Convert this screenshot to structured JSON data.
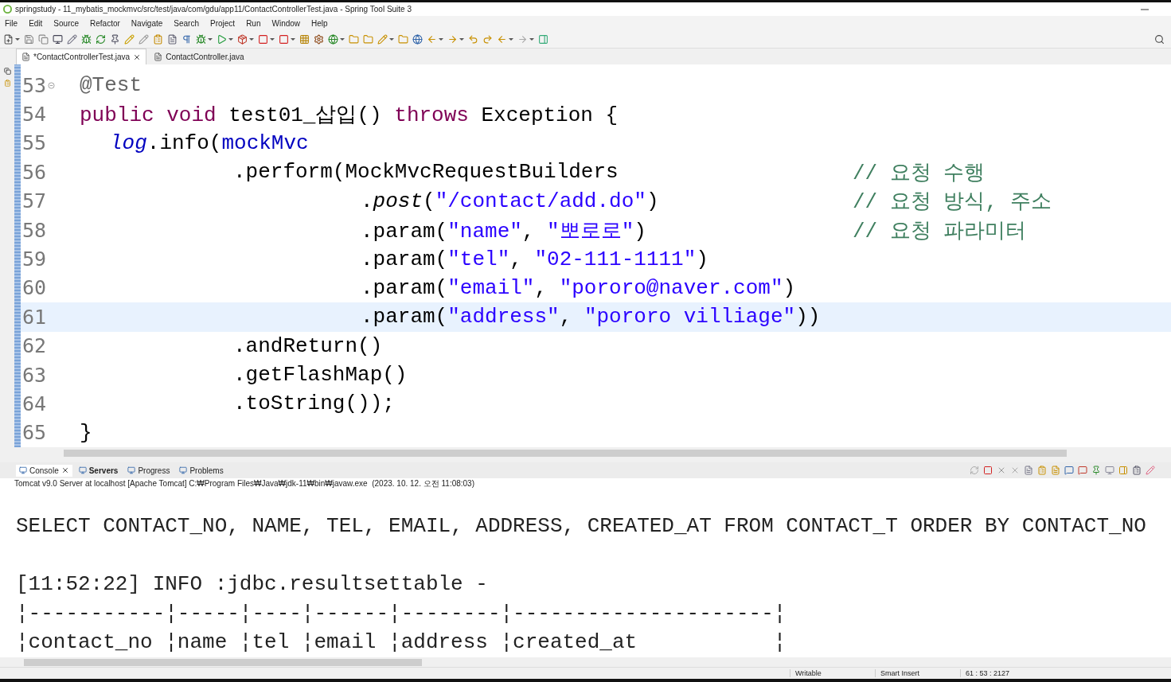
{
  "window": {
    "title": "springstudy - 11_mybatis_mockmvc/src/test/java/com/gdu/app11/ContactControllerTest.java - Spring Tool Suite 3"
  },
  "menu": [
    "File",
    "Edit",
    "Source",
    "Refactor",
    "Navigate",
    "Search",
    "Project",
    "Run",
    "Window",
    "Help"
  ],
  "editor_tabs": [
    {
      "label": "*ContactControllerTest.java",
      "selected": true
    },
    {
      "label": "ContactController.java",
      "selected": false
    }
  ],
  "editor": {
    "lines": [
      {
        "number": "53",
        "current": false,
        "fold": true,
        "segments": [
          {
            "kind": "annotation",
            "text": "@Test"
          }
        ]
      },
      {
        "number": "54",
        "current": false,
        "fold": false,
        "segments": [
          {
            "kind": "keyword",
            "text": "public void"
          },
          {
            "kind": "plain",
            "text": " test01_삽입() "
          },
          {
            "kind": "keyword",
            "text": "throws"
          },
          {
            "kind": "plain",
            "text": " Exception {"
          }
        ],
        "children": [
          {
            "number": "55",
            "current": false,
            "fold": false,
            "segments": [
              {
                "kind": "static",
                "text": "log"
              },
              {
                "kind": "plain",
                "text": ".info("
              },
              {
                "kind": "field",
                "text": "mockMvc"
              }
            ],
            "children": [
              {
                "number": "56",
                "current": false,
                "fold": false,
                "segments": [
                  {
                    "kind": "plain",
                    "text": ".perform(MockMvcRequestBuilders"
                  }
                ],
                "comment": "// 요청 수행",
                "children": [
                  {
                    "number": "57",
                    "current": false,
                    "fold": false,
                    "segments": [
                      {
                        "kind": "plain",
                        "text": "."
                      },
                      {
                        "kind": "method",
                        "text": "post"
                      },
                      {
                        "kind": "plain",
                        "text": "("
                      },
                      {
                        "kind": "string",
                        "text": "\"/contact/add.do\""
                      },
                      {
                        "kind": "plain",
                        "text": ")"
                      }
                    ],
                    "comment": "// 요청 방식, 주소"
                  },
                  {
                    "number": "58",
                    "current": false,
                    "fold": false,
                    "segments": [
                      {
                        "kind": "plain",
                        "text": ".param("
                      },
                      {
                        "kind": "string",
                        "text": "\"name\""
                      },
                      {
                        "kind": "plain",
                        "text": ", "
                      },
                      {
                        "kind": "string",
                        "text": "\"뽀로로\""
                      },
                      {
                        "kind": "plain",
                        "text": ")"
                      }
                    ],
                    "comment": "// 요청 파라미터"
                  },
                  {
                    "number": "59",
                    "current": false,
                    "fold": false,
                    "segments": [
                      {
                        "kind": "plain",
                        "text": ".param("
                      },
                      {
                        "kind": "string",
                        "text": "\"tel\""
                      },
                      {
                        "kind": "plain",
                        "text": ", "
                      },
                      {
                        "kind": "string",
                        "text": "\"02-111-1111\""
                      },
                      {
                        "kind": "plain",
                        "text": ")"
                      }
                    ]
                  },
                  {
                    "number": "60",
                    "current": false,
                    "fold": false,
                    "segments": [
                      {
                        "kind": "plain",
                        "text": ".param("
                      },
                      {
                        "kind": "string",
                        "text": "\"email\""
                      },
                      {
                        "kind": "plain",
                        "text": ", "
                      },
                      {
                        "kind": "string",
                        "text": "\"pororo@naver.com\""
                      },
                      {
                        "kind": "plain",
                        "text": ")"
                      }
                    ]
                  },
                  {
                    "number": "61",
                    "current": true,
                    "fold": false,
                    "segments": [
                      {
                        "kind": "plain",
                        "text": ".param("
                      },
                      {
                        "kind": "string",
                        "text": "\"address\""
                      },
                      {
                        "kind": "plain",
                        "text": ", "
                      },
                      {
                        "kind": "string",
                        "text": "\"pororo villiage\""
                      },
                      {
                        "kind": "plain",
                        "text": "))"
                      }
                    ]
                  }
                ]
              },
              {
                "number": "62",
                "current": false,
                "fold": false,
                "segments": [
                  {
                    "kind": "plain",
                    "text": ".andReturn()"
                  }
                ]
              },
              {
                "number": "63",
                "current": false,
                "fold": false,
                "segments": [
                  {
                    "kind": "plain",
                    "text": ".getFlashMap()"
                  }
                ]
              },
              {
                "number": "64",
                "current": false,
                "fold": false,
                "segments": [
                  {
                    "kind": "plain",
                    "text": ".toString());"
                  }
                ]
              }
            ]
          }
        ]
      },
      {
        "number": "65",
        "current": false,
        "fold": false,
        "segments": [
          {
            "kind": "plain",
            "text": "}"
          }
        ]
      }
    ]
  },
  "console_tabs": [
    {
      "label": "Console",
      "selected": true,
      "emphasized": false
    },
    {
      "label": "Servers",
      "selected": false,
      "emphasized": true
    },
    {
      "label": "Progress",
      "selected": false,
      "emphasized": false
    },
    {
      "label": "Problems",
      "selected": false,
      "emphasized": false
    }
  ],
  "console": {
    "description": "Tomcat v9.0 Server at localhost [Apache Tomcat] C:₩Program Files₩Java₩jdk-11₩bin₩javaw.exe  (2023. 10. 12. 오전 11:08:03)",
    "lines": [
      {
        "kind": "sql",
        "text": "SELECT CONTACT_NO, NAME, TEL, EMAIL, ADDRESS, CREATED_AT FROM CONTACT_T ORDER BY CONTACT_NO"
      },
      {
        "kind": "log",
        "text": "[11:52:22] INFO :jdbc.resultsettable -"
      },
      {
        "kind": "table",
        "text": "¦-----------¦-----¦----¦------¦--------¦---------------------¦"
      },
      {
        "kind": "table",
        "text": "¦contact_no ¦name ¦tel ¦email ¦address ¦created_at           ¦"
      }
    ]
  },
  "status_bar": [
    "Writable",
    "Smart Insert",
    "61 : 53 : 2127"
  ]
}
